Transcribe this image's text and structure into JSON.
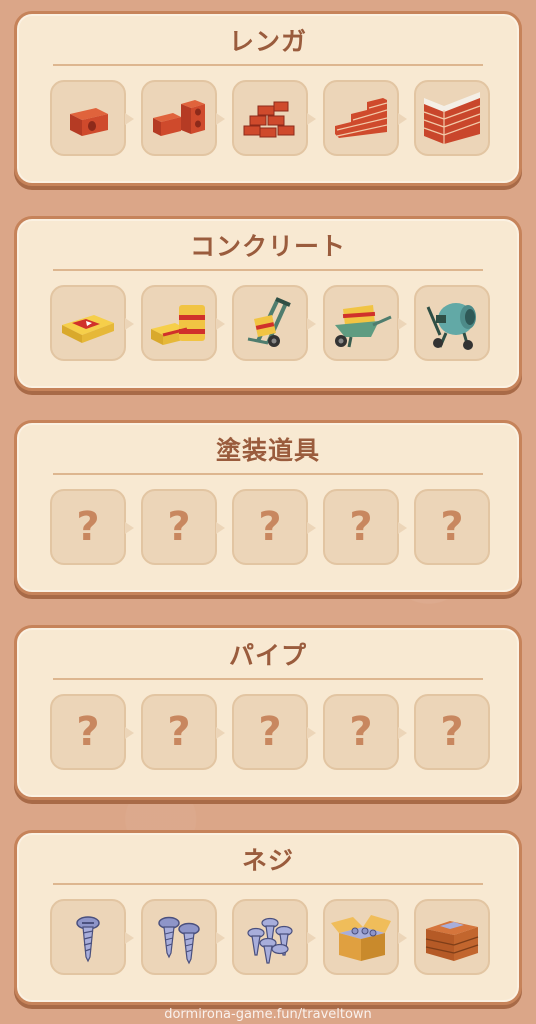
{
  "panels": [
    {
      "title": "レンガ",
      "slots": [
        {
          "state": "unlocked",
          "icon": "single-brick-icon"
        },
        {
          "state": "unlocked",
          "icon": "two-bricks-icon"
        },
        {
          "state": "unlocked",
          "icon": "brick-pile-icon"
        },
        {
          "state": "unlocked",
          "icon": "brick-steps-icon"
        },
        {
          "state": "unlocked",
          "icon": "brick-wall-icon"
        }
      ]
    },
    {
      "title": "コンクリート",
      "slots": [
        {
          "state": "unlocked",
          "icon": "cement-bag-icon"
        },
        {
          "state": "unlocked",
          "icon": "cement-bags-stack-icon"
        },
        {
          "state": "unlocked",
          "icon": "hand-truck-icon"
        },
        {
          "state": "unlocked",
          "icon": "wheelbarrow-icon"
        },
        {
          "state": "unlocked",
          "icon": "concrete-mixer-icon"
        }
      ]
    },
    {
      "title": "塗装道具",
      "slots": [
        {
          "state": "locked",
          "label": "?"
        },
        {
          "state": "locked",
          "label": "?"
        },
        {
          "state": "locked",
          "label": "?"
        },
        {
          "state": "locked",
          "label": "?"
        },
        {
          "state": "locked",
          "label": "?"
        }
      ]
    },
    {
      "title": "パイプ",
      "slots": [
        {
          "state": "locked",
          "label": "?"
        },
        {
          "state": "locked",
          "label": "?"
        },
        {
          "state": "locked",
          "label": "?"
        },
        {
          "state": "locked",
          "label": "?"
        },
        {
          "state": "locked",
          "label": "?"
        }
      ]
    },
    {
      "title": "ネジ",
      "slots": [
        {
          "state": "unlocked",
          "icon": "single-screw-icon"
        },
        {
          "state": "unlocked",
          "icon": "two-screws-icon"
        },
        {
          "state": "unlocked",
          "icon": "screw-pile-icon"
        },
        {
          "state": "unlocked",
          "icon": "open-screw-box-icon"
        },
        {
          "state": "unlocked",
          "icon": "closed-screw-crate-icon"
        }
      ]
    }
  ],
  "watermark": "dormirona-game.fun/traveltown",
  "colors": {
    "background": "#dba688",
    "panel": "#f8e9d2",
    "panel_border": "#c6835a",
    "title": "#9a5c3d",
    "slot": "#ecd5b8",
    "question_mark": "#c8875f"
  }
}
